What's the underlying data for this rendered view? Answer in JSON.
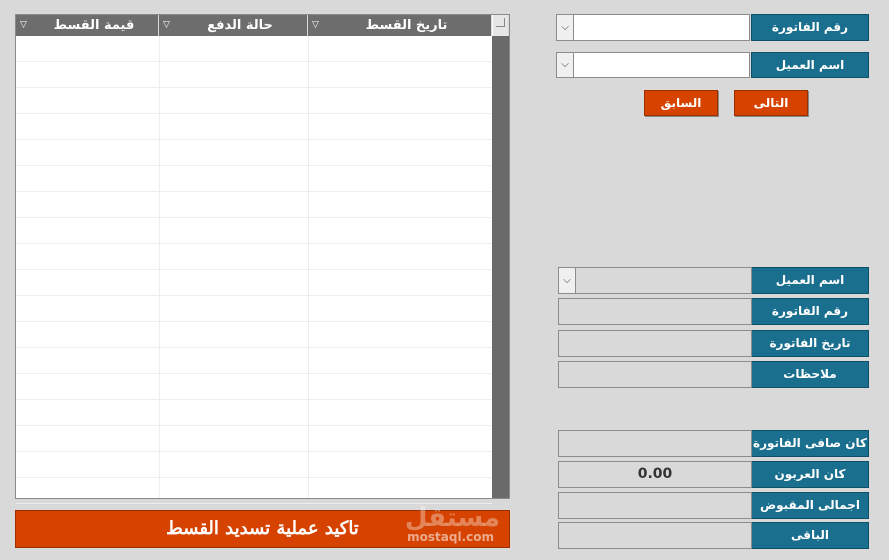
{
  "grid": {
    "columns": [
      {
        "label": "قيمة القسط"
      },
      {
        "label": "حالة الدفع"
      },
      {
        "label": "تاريخ القسط"
      }
    ],
    "rows": []
  },
  "confirm_button": {
    "label": "تاكيد عملية تسديد القسط"
  },
  "watermark": {
    "logo": "مستقل",
    "url": "mostaql.com"
  },
  "search": {
    "invoice_number_label": "رقم الفاتورة",
    "invoice_number_value": "",
    "customer_name_label": "اسم العميل",
    "customer_name_value": "",
    "next_label": "التالى",
    "previous_label": "السابق"
  },
  "details": {
    "customer_name_label": "اسم العميل",
    "customer_name_value": "",
    "invoice_number_label": "رقم الفاتورة",
    "invoice_number_value": "",
    "invoice_date_label": "تاريخ الفاتورة",
    "invoice_date_value": "",
    "notes_label": "ملاحظات",
    "notes_value": ""
  },
  "totals": {
    "net_invoice_label": "كان صافى الفاتورة",
    "net_invoice_value": "",
    "deposit_label": "كان العربون",
    "deposit_value": "0.00",
    "total_received_label": "اجمالى المقبوض",
    "total_received_value": "",
    "remaining_label": "الباقى",
    "remaining_value": ""
  },
  "colors": {
    "label_blue": "#1a6e8e",
    "action_orange": "#d64300",
    "grid_header": "#6d6d6d",
    "background": "#d9d9d9"
  }
}
